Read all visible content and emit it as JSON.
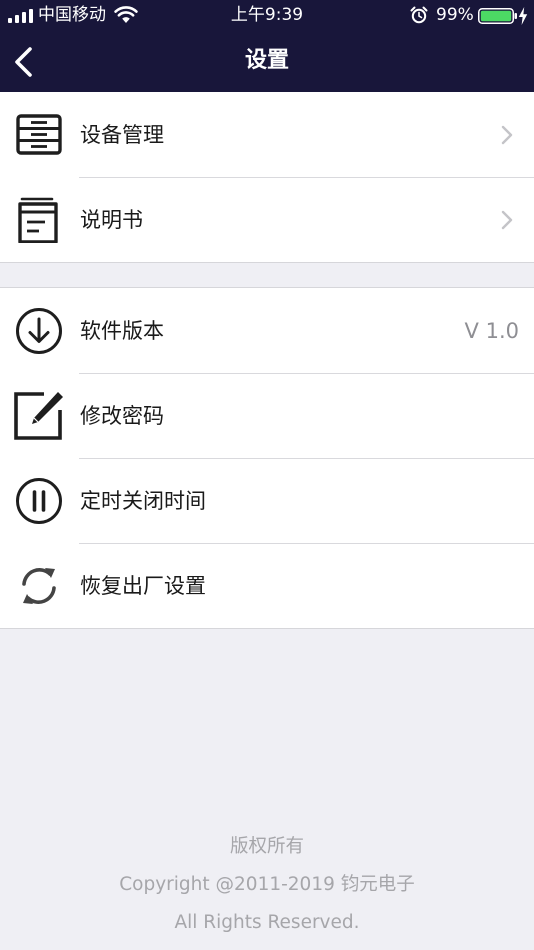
{
  "status_bar": {
    "carrier": "中国移动",
    "time": "上午9:39",
    "battery": "99%"
  },
  "nav": {
    "title": "设置"
  },
  "group1": [
    {
      "label": "设备管理",
      "icon": "device-management-icon"
    },
    {
      "label": "说明书",
      "icon": "manual-icon"
    }
  ],
  "group2": [
    {
      "label": "软件版本",
      "value": "V 1.0",
      "icon": "download-circle-icon"
    },
    {
      "label": "修改密码",
      "icon": "edit-icon"
    },
    {
      "label": "定时关闭时间",
      "icon": "pause-circle-icon"
    },
    {
      "label": "恢复出厂设置",
      "icon": "refresh-icon"
    }
  ],
  "footer": {
    "line1": "版权所有",
    "line2": "Copyright @2011-2019 钧元电子",
    "line3": "All Rights Reserved."
  },
  "colors": {
    "nav_background": "#18163a",
    "page_background": "#efeff4",
    "battery_green": "#4cd964"
  }
}
